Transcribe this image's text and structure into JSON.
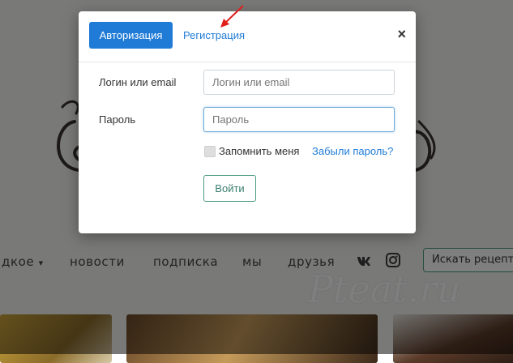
{
  "background": {
    "nav": {
      "items": [
        "дкое",
        "новости",
        "подписка",
        "мы",
        "друзья"
      ]
    },
    "social_icons": [
      "vk-icon",
      "instagram-icon"
    ],
    "search_button_label": "Искать рецепт",
    "watermark": "Pteat.ru"
  },
  "modal": {
    "tabs": {
      "login": "Авторизация",
      "register": "Регистрация"
    },
    "close_label": "×",
    "fields": {
      "login_label": "Логин или email",
      "login_placeholder": "Логин или email",
      "password_label": "Пароль",
      "password_placeholder": "Пароль"
    },
    "remember_label": "Запомнить меня",
    "forgot_label": "Забыли пароль?",
    "submit_label": "Войти"
  },
  "colors": {
    "accent_blue": "#1f7bd6",
    "accent_green": "#4a9a84",
    "annotation_arrow": "#e0201c"
  }
}
